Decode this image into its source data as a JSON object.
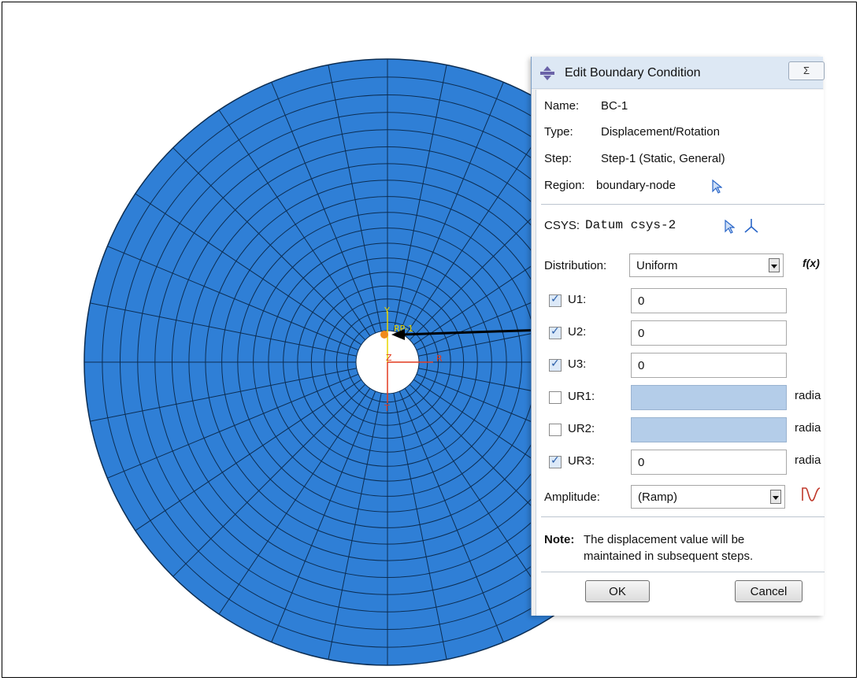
{
  "viewport": {
    "mesh_color": "#2f7fd6",
    "triad": {
      "y_label": "Y",
      "z_label": "Z",
      "x_label": "R",
      "theta_label": "T",
      "ref_point_label": "RP-1"
    }
  },
  "dialog": {
    "title": "Edit Boundary Condition",
    "close_label": "Σ",
    "name_label": "Name:",
    "name_value": "BC-1",
    "type_label": "Type:",
    "type_value": "Displacement/Rotation",
    "step_label": "Step:",
    "step_value": "Step-1 (Static, General)",
    "region_label": "Region:",
    "region_value": "boundary-node",
    "csys_label": "CSYS:",
    "csys_value": "Datum csys-2",
    "distribution_label": "Distribution:",
    "distribution_value": "Uniform",
    "fx_label": "f(x)",
    "dofs": [
      {
        "label": "U1:",
        "checked": true,
        "value": "0",
        "unit": ""
      },
      {
        "label": "U2:",
        "checked": true,
        "value": "0",
        "unit": ""
      },
      {
        "label": "U3:",
        "checked": true,
        "value": "0",
        "unit": ""
      },
      {
        "label": "UR1:",
        "checked": false,
        "value": "",
        "unit": "radia"
      },
      {
        "label": "UR2:",
        "checked": false,
        "value": "",
        "unit": "radia"
      },
      {
        "label": "UR3:",
        "checked": true,
        "value": "0",
        "unit": "radia"
      }
    ],
    "amplitude_label": "Amplitude:",
    "amplitude_value": "(Ramp)",
    "note_label": "Note:",
    "note_line1": "The displacement value will be",
    "note_line2": "maintained in subsequent steps.",
    "ok_label": "OK",
    "cancel_label": "Cancel"
  }
}
